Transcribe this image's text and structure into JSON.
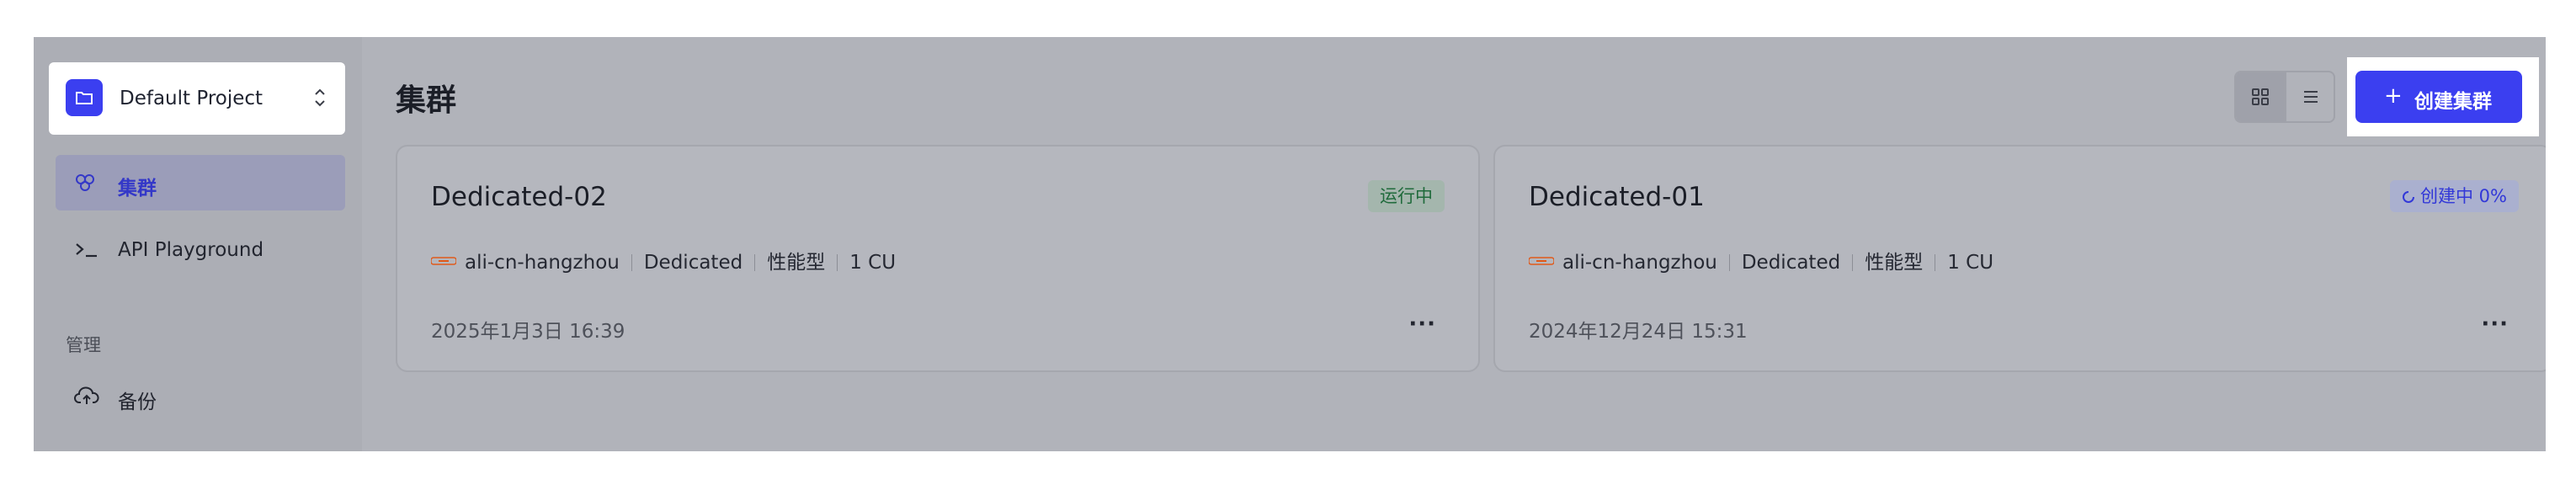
{
  "sidebar": {
    "project_name": "Default Project",
    "items": [
      {
        "label": "集群",
        "icon": "cluster-icon",
        "active": true
      },
      {
        "label": "API Playground",
        "icon": "terminal-icon",
        "active": false
      }
    ],
    "section_label": "管理",
    "manage_items": [
      {
        "label": "备份",
        "icon": "cloud-upload-icon"
      }
    ]
  },
  "main": {
    "title": "集群",
    "view_toggle": {
      "grid_icon": "grid-icon",
      "list_icon": "list-icon",
      "selected": "grid"
    },
    "create_button": {
      "plus": "+",
      "label": "创建集群"
    }
  },
  "clusters": [
    {
      "name": "Dedicated-02",
      "status": "运行中",
      "region": "ali-cn-hangzhou",
      "type": "Dedicated",
      "performance": "性能型",
      "capacity": "1 CU",
      "created": "2025年1月3日 16:39",
      "more": "···"
    },
    {
      "name": "Dedicated-01",
      "status": "创建中 0%",
      "region": "ali-cn-hangzhou",
      "type": "Dedicated",
      "performance": "性能型",
      "capacity": "1 CU",
      "created": "2024年12月24日 15:31",
      "more": "···"
    }
  ],
  "colors": {
    "accent": "#3b3ff0",
    "running": "#1f6a3b",
    "creating": "#3238d8",
    "overlay": "#b1b3ba"
  }
}
